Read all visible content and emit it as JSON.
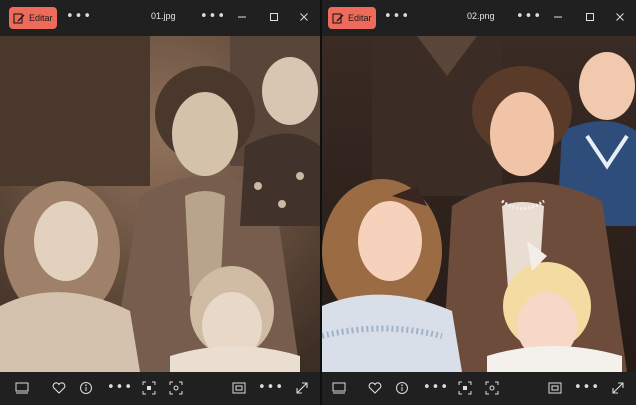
{
  "left_window": {
    "edit_label": "Editar",
    "file_name": "01.jpg"
  },
  "right_window": {
    "edit_label": "Editar",
    "file_name": "02.png"
  },
  "colors": {
    "accent": "#ee6a5a",
    "chrome": "#202020"
  },
  "icons": [
    "edit-icon",
    "more-icon",
    "minimize-icon",
    "maximize-icon",
    "close-icon",
    "filmstrip-icon",
    "heart-icon",
    "info-icon",
    "crop-icon",
    "select-icon",
    "fit-icon",
    "expand-icon"
  ]
}
